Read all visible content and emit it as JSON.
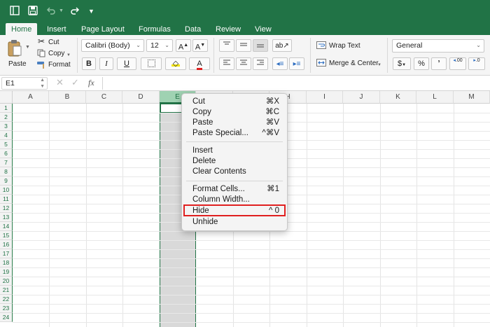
{
  "ribbon_tabs": [
    "Home",
    "Insert",
    "Page Layout",
    "Formulas",
    "Data",
    "Review",
    "View"
  ],
  "clipboard": {
    "paste": "Paste",
    "cut": "Cut",
    "copy": "Copy",
    "format": "Format"
  },
  "font": {
    "name": "Calibri (Body)",
    "size": "12",
    "bold": "B",
    "italic": "I",
    "underline": "U",
    "font_color_glyph": "A"
  },
  "alignment": {
    "wrap_text": "Wrap Text",
    "merge_center": "Merge & Center"
  },
  "number": {
    "format": "General",
    "currency": "$",
    "percent": "%",
    "comma": "ʼ",
    "inc_decimal": ".00",
    "dec_decimal": ".0"
  },
  "formula_bar": {
    "name_box": "E1",
    "fx": "fx",
    "content": ""
  },
  "columns": [
    "A",
    "B",
    "C",
    "D",
    "E",
    "F",
    "G",
    "H",
    "I",
    "J",
    "K",
    "L",
    "M"
  ],
  "rows": [
    "1",
    "2",
    "3",
    "4",
    "5",
    "6",
    "7",
    "8",
    "9",
    "10",
    "11",
    "12",
    "13",
    "14",
    "15",
    "16",
    "17",
    "18",
    "19",
    "20",
    "21",
    "22",
    "23",
    "24"
  ],
  "context_menu": {
    "groups": [
      [
        {
          "label": "Cut",
          "shortcut": "⌘X"
        },
        {
          "label": "Copy",
          "shortcut": "⌘C"
        },
        {
          "label": "Paste",
          "shortcut": "⌘V"
        },
        {
          "label": "Paste Special...",
          "shortcut": "^⌘V"
        }
      ],
      [
        {
          "label": "Insert",
          "shortcut": ""
        },
        {
          "label": "Delete",
          "shortcut": ""
        },
        {
          "label": "Clear Contents",
          "shortcut": ""
        }
      ],
      [
        {
          "label": "Format Cells...",
          "shortcut": "⌘1"
        },
        {
          "label": "Column Width...",
          "shortcut": ""
        },
        {
          "label": "Hide",
          "shortcut": "^ 0"
        },
        {
          "label": "Unhide",
          "shortcut": ""
        }
      ]
    ],
    "highlighted_item": "Hide"
  },
  "colors": {
    "accent": "#217346",
    "highlight_box": "#e02020",
    "selected_column": "#d9d9d9"
  }
}
